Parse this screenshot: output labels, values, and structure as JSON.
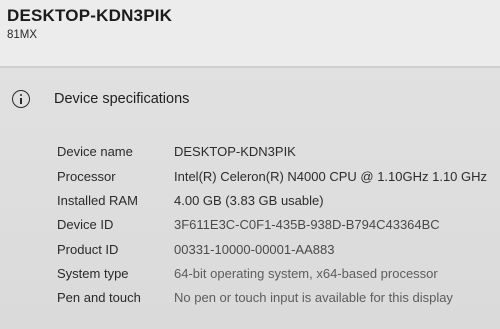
{
  "header": {
    "device_name": "DESKTOP-KDN3PIK",
    "model": "81MX"
  },
  "section": {
    "title": "Device specifications",
    "icon": "info-icon"
  },
  "specs": [
    {
      "label": "Device name",
      "value": "DESKTOP-KDN3PIK"
    },
    {
      "label": "Processor",
      "value": "Intel(R) Celeron(R) N4000 CPU @ 1.10GHz   1.10 GHz"
    },
    {
      "label": "Installed RAM",
      "value": "4.00 GB (3.83 GB usable)"
    },
    {
      "label": "Device ID",
      "value": "3F611E3C-C0F1-435B-938D-B794C43364BC"
    },
    {
      "label": "Product ID",
      "value": "00331-10000-00001-AA883"
    },
    {
      "label": "System type",
      "value": "64-bit operating system, x64-based processor"
    },
    {
      "label": "Pen and touch",
      "value": "No pen or touch input is available for this display"
    }
  ]
}
